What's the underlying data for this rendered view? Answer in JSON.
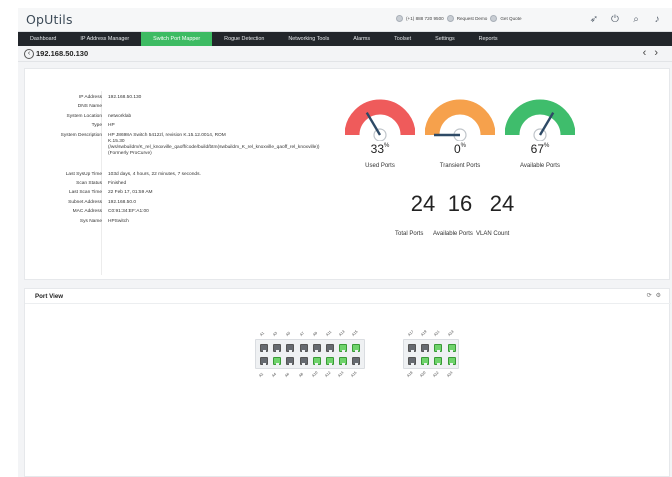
{
  "app": {
    "name": "OpUtils"
  },
  "topbar": {
    "phone": "(+1) 888 720 9500",
    "request_demo": "Request Demo",
    "get_quote": "Get Quote",
    "icons": [
      "rocket-icon",
      "plug-icon",
      "search-icon",
      "bell-icon",
      "gear-icon",
      "avatar"
    ]
  },
  "nav": {
    "tabs": [
      {
        "label": "Dashboard",
        "active": false
      },
      {
        "label": "IP Address Manager",
        "active": false
      },
      {
        "label": "Switch Port Mapper",
        "active": true
      },
      {
        "label": "Rogue Detection",
        "active": false
      },
      {
        "label": "Networking Tools",
        "active": false
      },
      {
        "label": "Alarms",
        "active": false
      },
      {
        "label": "Toolset",
        "active": false
      },
      {
        "label": "Settings",
        "active": false
      },
      {
        "label": "Reports",
        "active": false
      }
    ]
  },
  "breadcrumb": {
    "title": "192.168.50.130",
    "prev": "‹",
    "next": "›"
  },
  "details": [
    {
      "key": "IP Address",
      "value": "192.168.50.130"
    },
    {
      "key": "DNS Name",
      "value": ""
    },
    {
      "key": "System Location",
      "value": "networklab"
    },
    {
      "key": "Type",
      "value": "HP"
    },
    {
      "key": "System Description",
      "value": "HP J8698A Switch 5412zl, revision K.15.12.0014, ROM K.15.30 (/ws/swbuildm/K_rel_knoxville_qaoff/code/build/btm(swbuildm_K_rel_knoxville_qaoff_rel_knoxville)) (Formerly ProCurve)"
    },
    {
      "key": "Last SysUp Time",
      "value": "103d days, 4 hours, 22 minutes, 7 seconds."
    },
    {
      "key": "Scan Status",
      "value": "Finished"
    },
    {
      "key": "Last Scan Time",
      "value": "22 Feb 17, 01:59 AM"
    },
    {
      "key": "Subnet Address",
      "value": "192.168.50.0"
    },
    {
      "key": "MAC Address",
      "value": "C0:91:34:EF:A1:00"
    },
    {
      "key": "Sys Name",
      "value": "HPSwitch"
    }
  ],
  "gauges": [
    {
      "label": "Used Ports",
      "value": "33",
      "unit": "%",
      "fraction": 0.33,
      "color": "#ef5b5b"
    },
    {
      "label": "Transient Ports",
      "value": "0",
      "unit": "%",
      "fraction": 0.0,
      "color": "#f6a14c"
    },
    {
      "label": "Available Ports",
      "value": "67",
      "unit": "%",
      "fraction": 0.67,
      "color": "#3fbd6c"
    }
  ],
  "counts": [
    {
      "label": "Total Ports",
      "value": "24"
    },
    {
      "label": "Available Ports",
      "value": "16"
    },
    {
      "label": "VLAN Count",
      "value": "24"
    }
  ],
  "port_view": {
    "title": "Port View",
    "tool_icons": [
      "refresh-icon",
      "settings-icon"
    ],
    "switch1": {
      "top_labels": [
        "A1",
        "A3",
        "A5",
        "A7",
        "A9",
        "A11",
        "A13",
        "A15"
      ],
      "bottom_labels": [
        "A2",
        "A4",
        "A6",
        "A8",
        "A10",
        "A12",
        "A14",
        "A16"
      ],
      "top_up": [
        false,
        false,
        false,
        false,
        false,
        false,
        true,
        true
      ],
      "bottom_up": [
        false,
        true,
        false,
        false,
        true,
        true,
        true,
        false
      ]
    },
    "switch2": {
      "top_labels": [
        "A17",
        "A19",
        "A21",
        "A23"
      ],
      "bottom_labels": [
        "A18",
        "A20",
        "A22",
        "A24"
      ],
      "top_up": [
        false,
        false,
        true,
        true
      ],
      "bottom_up": [
        false,
        true,
        true,
        true
      ]
    }
  }
}
